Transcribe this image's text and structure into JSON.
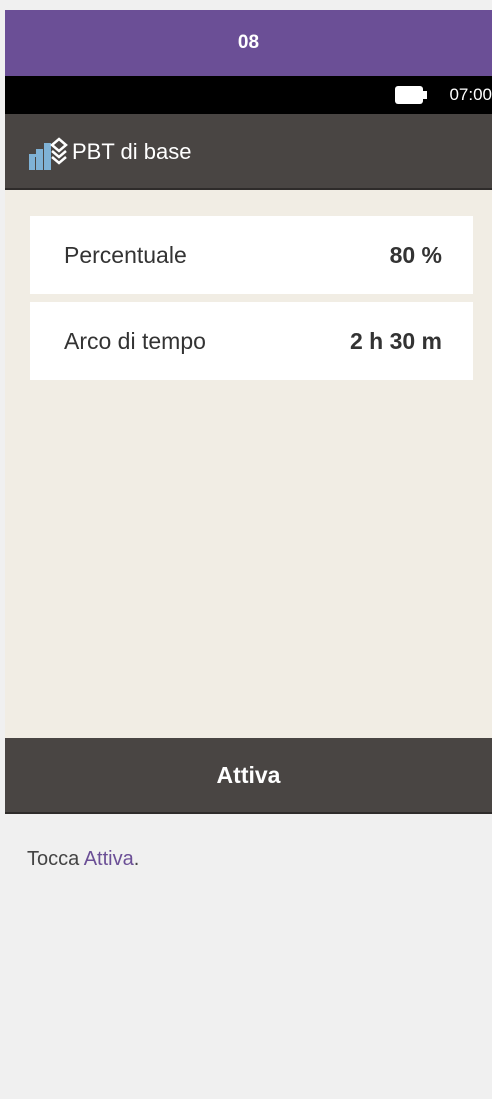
{
  "step": {
    "number": "08"
  },
  "statusbar": {
    "time": "07:00",
    "battery_icon": "battery-icon"
  },
  "titlebar": {
    "title": "PBT di base",
    "icon": "basal-rate-icon"
  },
  "settings": [
    {
      "label": "Percentuale",
      "value": "80 %"
    },
    {
      "label": "Arco di tempo",
      "value": "2 h 30 m"
    }
  ],
  "action": {
    "label": "Attiva"
  },
  "instruction": {
    "prefix": "Tocca ",
    "highlight": "Attiva",
    "suffix": "."
  },
  "colors": {
    "step_header": "#6b4f96",
    "titlebar": "#494543",
    "content_bg": "#f1ede4",
    "accent_text": "#6b4f96"
  }
}
